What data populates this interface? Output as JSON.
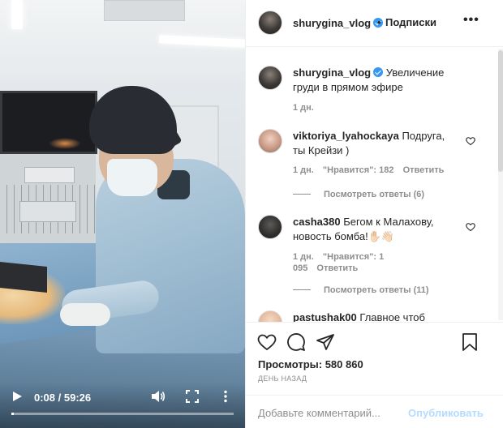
{
  "video": {
    "time": "0:08 / 59:26",
    "progress": 0.002,
    "icons": {
      "play": "play-icon",
      "volume": "volume-icon",
      "fullscreen": "fullscreen-icon",
      "more": "more-vertical-icon"
    }
  },
  "header": {
    "username": "shurygina_vlog",
    "separator": "•",
    "follow_label": "Подписки",
    "more_label": "•••"
  },
  "caption": {
    "username": "shurygina_vlog",
    "text": "Увеличение груди в прямом эфире",
    "time": "1 дн."
  },
  "comments": [
    {
      "username": "viktoriya_lyahockaya",
      "text": "Подруга, ты Крейзи )",
      "time": "1 дн.",
      "likes": "\"Нравится\": 182",
      "reply": "Ответить",
      "view_replies": "Посмотреть ответы (6)"
    },
    {
      "username": "casha380",
      "text": "Бегом к Малахову, новость бомба!✋🏻👋🏻",
      "time": "1 дн.",
      "likes": "\"Нравится\": 1 095",
      "reply": "Ответить",
      "view_replies": "Посмотреть ответы (11)"
    },
    {
      "username": "pastushak00",
      "text": "Главное чтоб",
      "time": "",
      "likes": "",
      "reply": "",
      "view_replies": ""
    }
  ],
  "actions": {
    "views": "Просмотры: 580 860",
    "date": "ДЕНЬ НАЗАД"
  },
  "add_comment": {
    "placeholder": "Добавьте комментарий...",
    "publish_label": "Опубликовать"
  },
  "colors": {
    "link_blue": "#3897f0",
    "publish_disabled": "#b3dbff",
    "muted_text": "#8e8e8e"
  }
}
